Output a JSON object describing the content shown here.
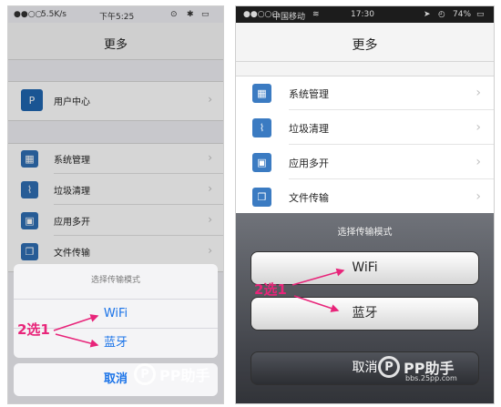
{
  "left": {
    "status": {
      "speed": "5.5K/s",
      "time": "下午5:25"
    },
    "nav_title": "更多",
    "user_center": {
      "label": "用户中心",
      "icon": "pp-logo-icon"
    },
    "menu": [
      {
        "label": "系统管理",
        "icon": "grid-icon"
      },
      {
        "label": "垃圾清理",
        "icon": "broom-icon"
      },
      {
        "label": "应用多开",
        "icon": "briefcase-icon"
      },
      {
        "label": "文件传输",
        "icon": "copy-icon"
      }
    ],
    "sheet": {
      "title": "选择传输模式",
      "options": [
        "WiFi",
        "蓝牙"
      ],
      "cancel": "取消"
    },
    "annotation": "2选1"
  },
  "right": {
    "status": {
      "carrier": "中国移动",
      "time": "17:30",
      "battery": "74%"
    },
    "nav_title": "更多",
    "menu": [
      {
        "label": "系统管理",
        "icon": "grid-icon"
      },
      {
        "label": "垃圾清理",
        "icon": "broom-icon"
      },
      {
        "label": "应用多开",
        "icon": "briefcase-icon"
      },
      {
        "label": "文件传输",
        "icon": "copy-icon"
      }
    ],
    "sheet": {
      "title": "选择传输模式",
      "options": [
        "WiFi",
        "蓝牙"
      ],
      "cancel": "取消"
    },
    "annotation": "2选1"
  },
  "watermark": {
    "text": "PP助手",
    "url": "bbs.25pp.com"
  },
  "colors": {
    "accent": "#1a73e8",
    "annotation": "#e8257a",
    "icon_blue": "#2f6eb3"
  }
}
